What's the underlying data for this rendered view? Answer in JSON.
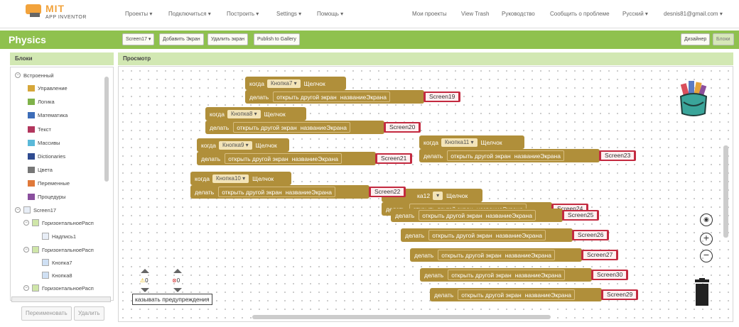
{
  "app": {
    "logo_main": "MIT",
    "logo_sub": "APP INVENTOR"
  },
  "nav": {
    "projects": "Проекты",
    "connect": "Подключиться",
    "build": "Построить",
    "settings": "Settings",
    "help": "Помощь",
    "my_projects": "Мои проекты",
    "view_trash": "View Trash",
    "guide": "Руководство",
    "report": "Сообщить о проблеме",
    "language": "Русский",
    "account": "desnis81@gmail.com"
  },
  "toolbar": {
    "project_name": "Physics",
    "screen_select": "Screen17",
    "add_screen": "Добавить Экран",
    "remove_screen": "Удалить экран",
    "publish": "Publish to Gallery",
    "designer": "Дизайнер",
    "blocks": "Блоки"
  },
  "blocks_panel": {
    "header": "Блоки",
    "builtin": "Встроенный",
    "categories": [
      {
        "label": "Управление",
        "color": "#d6a73a"
      },
      {
        "label": "Логика",
        "color": "#7fb24a"
      },
      {
        "label": "Математика",
        "color": "#3d6db8"
      },
      {
        "label": "Текст",
        "color": "#b2365d"
      },
      {
        "label": "Массивы",
        "color": "#5ab9d9"
      },
      {
        "label": "Dictionaries",
        "color": "#2f4b90"
      },
      {
        "label": "Цвета",
        "color": "#777777"
      },
      {
        "label": "Переменные",
        "color": "#e0793a"
      },
      {
        "label": "Процедуры",
        "color": "#8a4f9e"
      }
    ],
    "components": [
      {
        "label": "Screen17"
      },
      {
        "label": "ГоризонтальноеРасп"
      },
      {
        "label": "Надпись1"
      },
      {
        "label": "ГоризонтальноеРасп"
      },
      {
        "label": "Кнопка7"
      },
      {
        "label": "Кнопка8"
      },
      {
        "label": "ГоризонтальноеРасп"
      }
    ],
    "rename": "Переименовать",
    "delete": "Удалить"
  },
  "viewer": {
    "header": "Просмотр",
    "kw_when": "когда",
    "kw_do": "делать",
    "kw_click": "Щелчок",
    "kw_open": "открыть другой экран",
    "kw_name": "названиеЭкрана",
    "events": [
      {
        "button": "Кнопка7",
        "screen": "Screen19"
      },
      {
        "button": "Кнопка8",
        "screen": "Screen20"
      },
      {
        "button": "Кнопка9",
        "screen": "Screen21"
      },
      {
        "button": "Кнопка11",
        "screen": "Screen23"
      },
      {
        "button": "Кнопка10",
        "screen": "Screen22"
      },
      {
        "button": "ка12",
        "screen": "Screen24"
      }
    ],
    "do_only": [
      {
        "screen": "Screen25"
      },
      {
        "screen": "Screen26"
      },
      {
        "screen": "Screen27"
      },
      {
        "screen": "Screen30"
      },
      {
        "screen": "Screen29"
      }
    ],
    "warnings_count": "0",
    "errors_count": "0",
    "warnings_toggle": "казывать предупреждения"
  }
}
